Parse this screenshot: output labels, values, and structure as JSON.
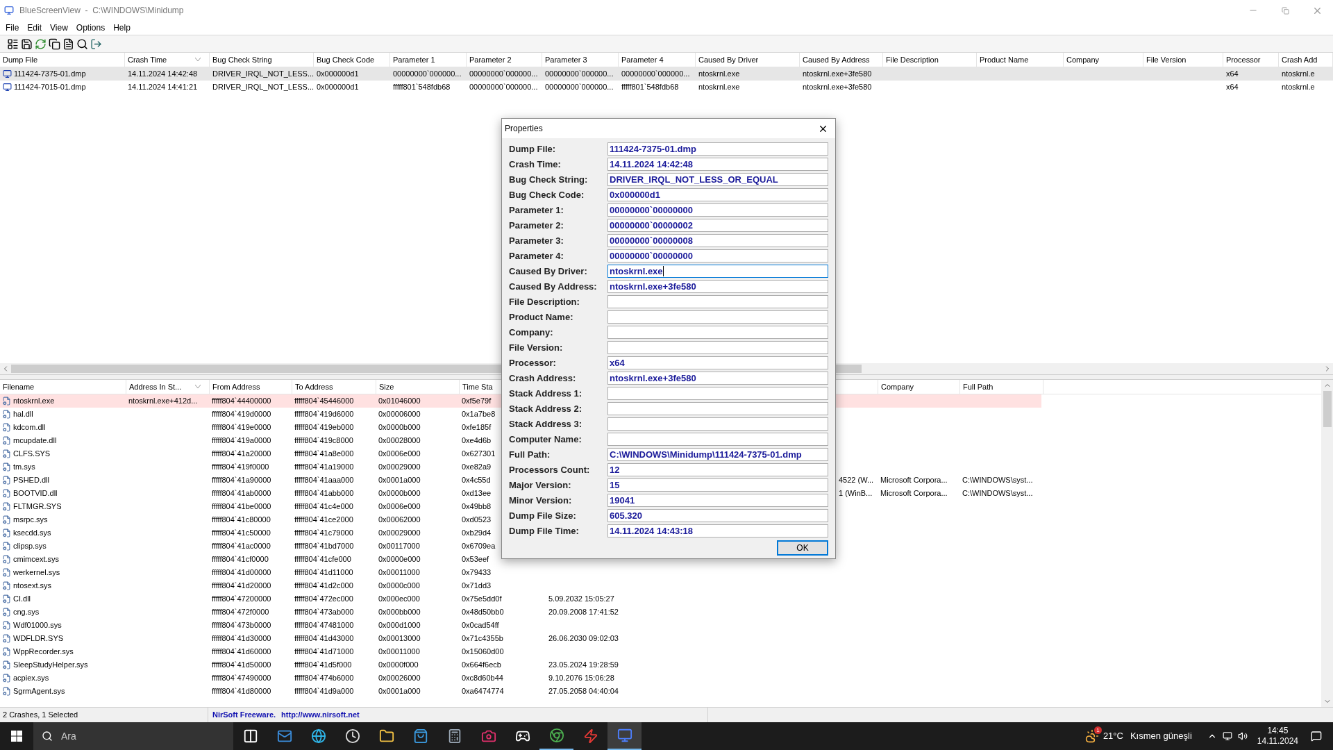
{
  "window": {
    "title": "BlueScreenView  -  C:\\WINDOWS\\Minidump"
  },
  "menu": [
    "File",
    "Edit",
    "View",
    "Options",
    "Help"
  ],
  "crashes": {
    "columns": [
      {
        "label": "Dump File",
        "sorted": false
      },
      {
        "label": "Crash Time",
        "sorted": true
      },
      {
        "label": "Bug Check String",
        "sorted": false
      },
      {
        "label": "Bug Check Code",
        "sorted": false
      },
      {
        "label": "Parameter 1",
        "sorted": false
      },
      {
        "label": "Parameter 2",
        "sorted": false
      },
      {
        "label": "Parameter 3",
        "sorted": false
      },
      {
        "label": "Parameter 4",
        "sorted": false
      },
      {
        "label": "Caused By Driver",
        "sorted": false
      },
      {
        "label": "Caused By Address",
        "sorted": false
      },
      {
        "label": "File Description",
        "sorted": false
      },
      {
        "label": "Product Name",
        "sorted": false
      },
      {
        "label": "Company",
        "sorted": false
      },
      {
        "label": "File Version",
        "sorted": false
      },
      {
        "label": "Processor",
        "sorted": false
      },
      {
        "label": "Crash Add",
        "sorted": false
      }
    ],
    "rows": [
      {
        "selected": true,
        "cells": [
          "111424-7375-01.dmp",
          "14.11.2024 14:42:48",
          "DRIVER_IRQL_NOT_LESS...",
          "0x000000d1",
          "00000000`000000...",
          "00000000`000000...",
          "00000000`000000...",
          "00000000`000000...",
          "ntoskrnl.exe",
          "ntoskrnl.exe+3fe580",
          null,
          null,
          null,
          null,
          "x64",
          "ntoskrnl.e"
        ]
      },
      {
        "selected": false,
        "cells": [
          "111424-7015-01.dmp",
          "14.11.2024 14:41:21",
          "DRIVER_IRQL_NOT_LESS...",
          "0x000000d1",
          "fffff801`548fdb68",
          "00000000`000000...",
          "00000000`000000...",
          "fffff801`548fdb68",
          "ntoskrnl.exe",
          "ntoskrnl.exe+3fe580",
          null,
          null,
          null,
          null,
          "x64",
          "ntoskrnl.e"
        ]
      }
    ]
  },
  "modules": {
    "columns": [
      {
        "label": "Filename",
        "sorted": false
      },
      {
        "label": "Address In St...",
        "sorted": true
      },
      {
        "label": "From Address",
        "sorted": false
      },
      {
        "label": "To Address",
        "sorted": false
      },
      {
        "label": "Size",
        "sorted": false
      },
      {
        "label": "Time Sta"
      },
      {},
      {},
      {
        "label": "Company",
        "sorted": false
      },
      {
        "label": "Full Path",
        "sorted": false
      }
    ],
    "rows": [
      {
        "highlighted": true,
        "cells": [
          "ntoskrnl.exe",
          "ntoskrnl.exe+412d...",
          "fffff804`44400000",
          "fffff804`45446000",
          "0x01046000",
          "0xf5e79f",
          null,
          null,
          null,
          null
        ]
      },
      {
        "highlighted": false,
        "cells": [
          "hal.dll",
          null,
          "fffff804`419d0000",
          "fffff804`419d6000",
          "0x00006000",
          "0x1a7be8",
          null,
          null,
          null,
          null
        ]
      },
      {
        "highlighted": false,
        "cells": [
          "kdcom.dll",
          null,
          "fffff804`419e0000",
          "fffff804`419eb000",
          "0x0000b000",
          "0xfe185f",
          null,
          null,
          null,
          null
        ]
      },
      {
        "highlighted": false,
        "cells": [
          "mcupdate.dll",
          null,
          "fffff804`419a0000",
          "fffff804`419c8000",
          "0x00028000",
          "0xe4d6b",
          null,
          null,
          null,
          null
        ]
      },
      {
        "highlighted": false,
        "cells": [
          "CLFS.SYS",
          null,
          "fffff804`41a20000",
          "fffff804`41a8e000",
          "0x0006e000",
          "0x627301",
          null,
          null,
          null,
          null
        ]
      },
      {
        "highlighted": false,
        "cells": [
          "tm.sys",
          null,
          "fffff804`419f0000",
          "fffff804`41a19000",
          "0x00029000",
          "0xe82a9",
          null,
          null,
          null,
          null
        ]
      },
      {
        "highlighted": false,
        "cells": [
          "PSHED.dll",
          null,
          "fffff804`41a90000",
          "fffff804`41aaa000",
          "0x0001a000",
          "0x4c55d",
          null,
          "4522 (W...",
          "Microsoft Corpora...",
          "C:\\WINDOWS\\syst..."
        ]
      },
      {
        "highlighted": false,
        "cells": [
          "BOOTVID.dll",
          null,
          "fffff804`41ab0000",
          "fffff804`41abb000",
          "0x0000b000",
          "0xd13ee",
          null,
          "1 (WinB...",
          "Microsoft Corpora...",
          "C:\\WINDOWS\\syst..."
        ]
      },
      {
        "highlighted": false,
        "cells": [
          "FLTMGR.SYS",
          null,
          "fffff804`41be0000",
          "fffff804`41c4e000",
          "0x0006e000",
          "0x49bb8",
          null,
          null,
          null,
          null
        ]
      },
      {
        "highlighted": false,
        "cells": [
          "msrpc.sys",
          null,
          "fffff804`41c80000",
          "fffff804`41ce2000",
          "0x00062000",
          "0xd0523",
          null,
          null,
          null,
          null
        ]
      },
      {
        "highlighted": false,
        "cells": [
          "ksecdd.sys",
          null,
          "fffff804`41c50000",
          "fffff804`41c79000",
          "0x00029000",
          "0xb29d4",
          null,
          null,
          null,
          null
        ]
      },
      {
        "highlighted": false,
        "cells": [
          "clipsp.sys",
          null,
          "fffff804`41ac0000",
          "fffff804`41bd7000",
          "0x00117000",
          "0x6709ea",
          null,
          null,
          null,
          null
        ]
      },
      {
        "highlighted": false,
        "cells": [
          "cmimcext.sys",
          null,
          "fffff804`41cf0000",
          "fffff804`41cfe000",
          "0x0000e000",
          "0x53eef",
          null,
          null,
          null,
          null
        ]
      },
      {
        "highlighted": false,
        "cells": [
          "werkernel.sys",
          null,
          "fffff804`41d00000",
          "fffff804`41d11000",
          "0x00011000",
          "0x79433",
          null,
          null,
          null,
          null
        ]
      },
      {
        "highlighted": false,
        "cells": [
          "ntosext.sys",
          null,
          "fffff804`41d20000",
          "fffff804`41d2c000",
          "0x0000c000",
          "0x71dd3",
          null,
          null,
          null,
          null
        ]
      },
      {
        "highlighted": false,
        "cells": [
          "CI.dll",
          null,
          "fffff804`47200000",
          "fffff804`472ec000",
          "0x000ec000",
          "0x75e5dd0f",
          "5.09.2032 15:05:27",
          null,
          null,
          null
        ]
      },
      {
        "highlighted": false,
        "cells": [
          "cng.sys",
          null,
          "fffff804`472f0000",
          "fffff804`473ab000",
          "0x000bb000",
          "0x48d50bb0",
          "20.09.2008 17:41:52",
          null,
          null,
          null
        ]
      },
      {
        "highlighted": false,
        "cells": [
          "Wdf01000.sys",
          null,
          "fffff804`473b0000",
          "fffff804`47481000",
          "0x000d1000",
          "0x0cad54ff",
          null,
          null,
          null,
          null
        ]
      },
      {
        "highlighted": false,
        "cells": [
          "WDFLDR.SYS",
          null,
          "fffff804`41d30000",
          "fffff804`41d43000",
          "0x00013000",
          "0x71c4355b",
          "26.06.2030 09:02:03",
          null,
          null,
          null
        ]
      },
      {
        "highlighted": false,
        "cells": [
          "WppRecorder.sys",
          null,
          "fffff804`41d60000",
          "fffff804`41d71000",
          "0x00011000",
          "0x15060d00",
          null,
          null,
          null,
          null
        ]
      },
      {
        "highlighted": false,
        "cells": [
          "SleepStudyHelper.sys",
          null,
          "fffff804`41d50000",
          "fffff804`41d5f000",
          "0x0000f000",
          "0x664f6ecb",
          "23.05.2024 19:28:59",
          null,
          null,
          null
        ]
      },
      {
        "highlighted": false,
        "cells": [
          "acpiex.sys",
          null,
          "fffff804`47490000",
          "fffff804`474b6000",
          "0x00026000",
          "0xc8d60b44",
          "9.10.2076 15:06:28",
          null,
          null,
          null
        ]
      },
      {
        "highlighted": false,
        "cells": [
          "SgrmAgent.sys",
          null,
          "fffff804`41d80000",
          "fffff804`41d9a000",
          "0x0001a000",
          "0xa6474774",
          "27.05.2058 04:40:04",
          null,
          null,
          null
        ]
      }
    ]
  },
  "properties_dialog": {
    "title": "Properties",
    "button": "OK",
    "fields": [
      {
        "label": "Dump File:",
        "value": "111424-7375-01.dmp",
        "focused": false
      },
      {
        "label": "Crash Time:",
        "value": "14.11.2024 14:42:48",
        "focused": false
      },
      {
        "label": "Bug Check String:",
        "value": "DRIVER_IRQL_NOT_LESS_OR_EQUAL",
        "focused": false
      },
      {
        "label": "Bug Check Code:",
        "value": "0x000000d1",
        "focused": false
      },
      {
        "label": "Parameter 1:",
        "value": "00000000`00000000",
        "focused": false
      },
      {
        "label": "Parameter 2:",
        "value": "00000000`00000002",
        "focused": false
      },
      {
        "label": "Parameter 3:",
        "value": "00000000`00000008",
        "focused": false
      },
      {
        "label": "Parameter 4:",
        "value": "00000000`00000000",
        "focused": false
      },
      {
        "label": "Caused By Driver:",
        "value": "ntoskrnl.exe",
        "focused": true
      },
      {
        "label": "Caused By Address:",
        "value": "ntoskrnl.exe+3fe580",
        "focused": false
      },
      {
        "label": "File Description:",
        "focused": false
      },
      {
        "label": "Product Name:",
        "focused": false
      },
      {
        "label": "Company:",
        "focused": false
      },
      {
        "label": "File Version:",
        "focused": false
      },
      {
        "label": "Processor:",
        "value": "x64",
        "focused": false
      },
      {
        "label": "Crash Address:",
        "value": "ntoskrnl.exe+3fe580",
        "focused": false
      },
      {
        "label": "Stack Address 1:",
        "focused": false
      },
      {
        "label": "Stack Address 2:",
        "focused": false
      },
      {
        "label": "Stack Address 3:",
        "focused": false
      },
      {
        "label": "Computer Name:",
        "focused": false
      },
      {
        "label": "Full Path:",
        "value": "C:\\WINDOWS\\Minidump\\111424-7375-01.dmp",
        "focused": false
      },
      {
        "label": "Processors Count:",
        "value": "12",
        "focused": false
      },
      {
        "label": "Major Version:",
        "value": "15",
        "focused": false
      },
      {
        "label": "Minor Version:",
        "value": "19041",
        "focused": false
      },
      {
        "label": "Dump File Size:",
        "value": "605.320",
        "focused": false
      },
      {
        "label": "Dump File Time:",
        "value": "14.11.2024 14:43:18",
        "focused": false
      }
    ]
  },
  "status_bar": {
    "summary": "2 Crashes, 1 Selected",
    "credit": "NirSoft Freeware.",
    "link": "http://www.nirsoft.net"
  },
  "taskbar": {
    "search_placeholder": "Ara",
    "apps": [
      {
        "kind": "task_view",
        "running": false,
        "active": false
      },
      {
        "kind": "mail",
        "running": false,
        "active": false
      },
      {
        "kind": "browser",
        "running": false,
        "active": false
      },
      {
        "kind": "clock",
        "running": false,
        "active": false
      },
      {
        "kind": "folder",
        "running": false,
        "active": false
      },
      {
        "kind": "store",
        "running": false,
        "active": false
      },
      {
        "kind": "calculator",
        "running": false,
        "active": false
      },
      {
        "kind": "camera",
        "running": false,
        "active": false
      },
      {
        "kind": "gamepad",
        "running": false,
        "active": false
      },
      {
        "kind": "chrome",
        "running": true,
        "active": false
      },
      {
        "kind": "bolt",
        "running": false,
        "active": false
      },
      {
        "kind": "monitor",
        "running": true,
        "active": true
      }
    ],
    "weather": {
      "badge": "1",
      "temperature": "21°C",
      "condition": "Kısmen güneşli"
    },
    "clock": {
      "time": "14:45",
      "date": "14.11.2024"
    }
  }
}
